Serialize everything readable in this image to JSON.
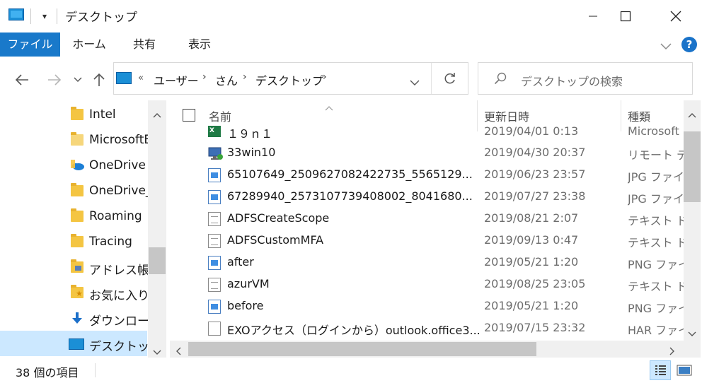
{
  "window": {
    "title": "デスクトップ",
    "qat_label": "▾"
  },
  "ribbon": {
    "tabs": [
      "ファイル",
      "ホーム",
      "共有",
      "表示"
    ]
  },
  "address": {
    "overflow": "«",
    "crumbs": [
      "ユーザー",
      "さん",
      "デスクトップ"
    ]
  },
  "search": {
    "placeholder": "デスクトップの検索"
  },
  "navpane": {
    "items": [
      {
        "label": "Intel",
        "icon": "folder-icon"
      },
      {
        "label": "MicrosoftE",
        "icon": "folder-icon"
      },
      {
        "label": "OneDrive -",
        "icon": "cloud-icon"
      },
      {
        "label": "OneDrive_",
        "icon": "folder-icon"
      },
      {
        "label": "Roaming",
        "icon": "folder-icon"
      },
      {
        "label": "Tracing",
        "icon": "folder-icon"
      },
      {
        "label": "アドレス帳",
        "icon": "contacts-folder-icon"
      },
      {
        "label": "お気に入り",
        "icon": "favorites-folder-icon"
      },
      {
        "label": "ダウンロード",
        "icon": "download-arrow-icon"
      },
      {
        "label": "デスクトップ",
        "icon": "desktop-icon",
        "selected": true
      }
    ]
  },
  "filelist": {
    "columns": {
      "name": "名前",
      "date": "更新日時",
      "type": "種類"
    },
    "rows": [
      {
        "name": "１９ｎ１",
        "date": "2019/04/01 0:13",
        "type": "Microsoft",
        "icon": "excel-icon"
      },
      {
        "name": "33win10",
        "date": "2019/04/30 20:37",
        "type": "リモート デス",
        "icon": "remote-desktop-icon"
      },
      {
        "name": "65107649_2509627082422735_5565129...",
        "date": "2019/06/23 23:57",
        "type": "JPG ファイル",
        "icon": "image-file-icon"
      },
      {
        "name": "67289940_2573107739408002_8041680...",
        "date": "2019/07/27 23:38",
        "type": "JPG ファイル",
        "icon": "image-file-icon"
      },
      {
        "name": "ADFSCreateScope",
        "date": "2019/08/21 2:07",
        "type": "テキスト ドキ",
        "icon": "text-file-icon"
      },
      {
        "name": "ADFSCustomMFA",
        "date": "2019/09/13 0:47",
        "type": "テキスト ドキ",
        "icon": "text-file-icon"
      },
      {
        "name": "after",
        "date": "2019/05/21 1:20",
        "type": "PNG ファイル",
        "icon": "image-file-icon"
      },
      {
        "name": "azurVM",
        "date": "2019/08/25 23:05",
        "type": "テキスト ドキ",
        "icon": "text-file-icon"
      },
      {
        "name": "before",
        "date": "2019/05/21 1:20",
        "type": "PNG ファイル",
        "icon": "image-file-icon"
      },
      {
        "name": "EXOアクセス（ログインから）outlook.office3...",
        "date": "2019/07/15 23:32",
        "type": "HAR ファイル",
        "icon": "blank-file-icon"
      }
    ]
  },
  "status": {
    "count_text": "38 個の項目"
  },
  "colors": {
    "accent": "#1979ca",
    "selection": "#cce8ff",
    "help": "#1a73c9"
  }
}
